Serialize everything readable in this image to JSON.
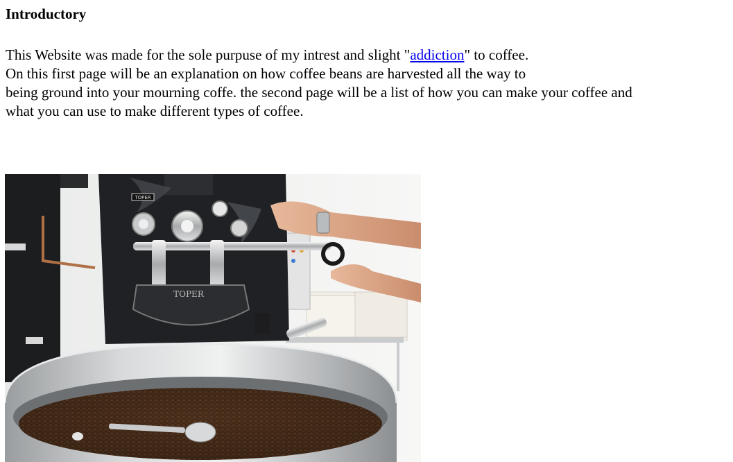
{
  "page": {
    "heading": "Introductory",
    "intro": {
      "line1_before_link": "This Website was made for the sole purpuse of my intrest and slight \"",
      "link_text": "addiction",
      "line1_after_link": "\" to coffee.",
      "line2": "On this first page will be an explanation on how coffee beans are harvested all the way to",
      "line3": "being ground into your mourning coffe. the second page will be a list of how you can make your coffee and",
      "line4": "what you can use to make different types of coffee."
    },
    "image": {
      "description_icon": "coffee-roaster-photo",
      "machine_label_top": "TOPER",
      "machine_label_door": "TOPER"
    }
  },
  "colors": {
    "link": "#0000ee",
    "text": "#000000",
    "background": "#ffffff"
  }
}
